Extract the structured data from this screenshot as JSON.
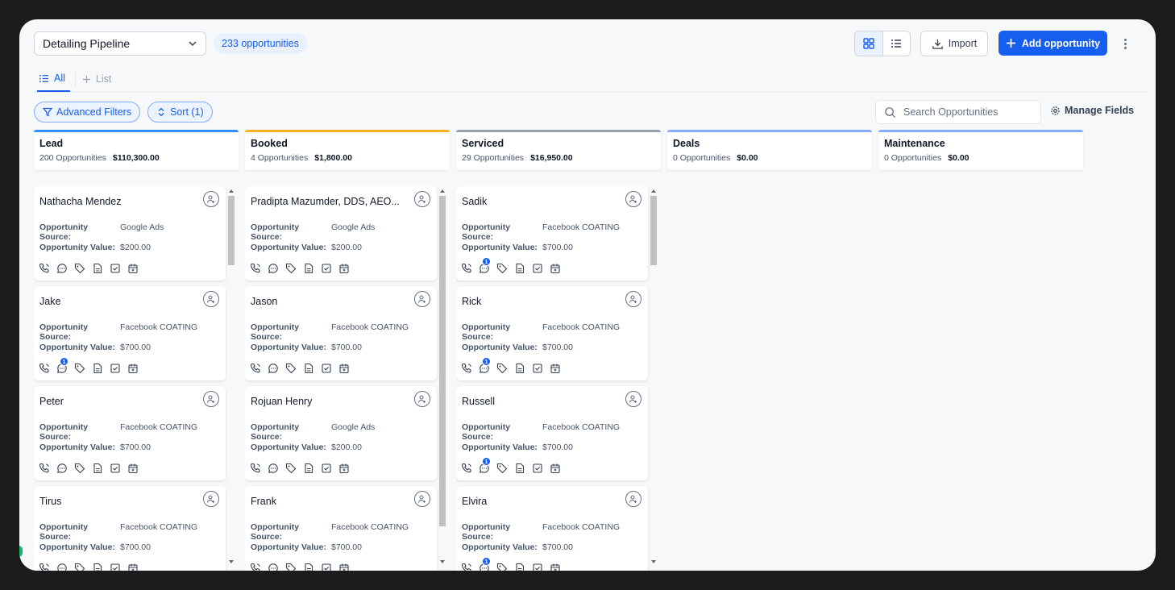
{
  "header": {
    "pipeline": "Detailing Pipeline",
    "opportunity_count": "233 opportunities",
    "import_label": "Import",
    "add_label": "Add opportunity"
  },
  "tabs": {
    "all": "All",
    "list": "List"
  },
  "filters": {
    "advanced": "Advanced Filters",
    "sort": "Sort (1)",
    "search_placeholder": "Search Opportunities",
    "manage_fields": "Manage Fields"
  },
  "colors": {
    "accent": "#155eef",
    "lead": "#2e90fa",
    "booked": "#fdb022",
    "serviced": "#98a2b3",
    "deals": "#84adff",
    "maintenance": "#84adff"
  },
  "stages": [
    {
      "name": "Lead",
      "count": "200 Opportunities",
      "amount": "$110,300.00"
    },
    {
      "name": "Booked",
      "count": "4 Opportunities",
      "amount": "$1,800.00"
    },
    {
      "name": "Serviced",
      "count": "29 Opportunities",
      "amount": "$16,950.00"
    },
    {
      "name": "Deals",
      "count": "0 Opportunities",
      "amount": "$0.00"
    },
    {
      "name": "Maintenance",
      "count": "0 Opportunities",
      "amount": "$0.00"
    }
  ],
  "field_labels": {
    "source": "Opportunity Source:",
    "value": "Opportunity Value:"
  },
  "columns": [
    {
      "cards": [
        {
          "name": "Nathacha Mendez",
          "source": "Google Ads",
          "value": "$200.00",
          "badge": ""
        },
        {
          "name": "Jake",
          "source": "Facebook COATING",
          "value": "$700.00",
          "badge": "1"
        },
        {
          "name": "Peter",
          "source": "Facebook COATING",
          "value": "$700.00",
          "badge": ""
        },
        {
          "name": "Tirus",
          "source": "Facebook COATING",
          "value": "$700.00",
          "badge": ""
        }
      ]
    },
    {
      "cards": [
        {
          "name": "Pradipta Mazumder, DDS, AEO...",
          "source": "Google Ads",
          "value": "$200.00",
          "badge": ""
        },
        {
          "name": "Jason",
          "source": "Facebook COATING",
          "value": "$700.00",
          "badge": ""
        },
        {
          "name": "Rojuan Henry",
          "source": "Google Ads",
          "value": "$200.00",
          "badge": ""
        },
        {
          "name": "Frank",
          "source": "Facebook COATING",
          "value": "$700.00",
          "badge": ""
        }
      ]
    },
    {
      "cards": [
        {
          "name": "Sadik",
          "source": "Facebook COATING",
          "value": "$700.00",
          "badge": "1"
        },
        {
          "name": "Rick",
          "source": "Facebook COATING",
          "value": "$700.00",
          "badge": "1"
        },
        {
          "name": "Russell",
          "source": "Facebook COATING",
          "value": "$700.00",
          "badge": "1"
        },
        {
          "name": "Elvira",
          "source": "Facebook COATING",
          "value": "$700.00",
          "badge": "1"
        }
      ]
    }
  ]
}
